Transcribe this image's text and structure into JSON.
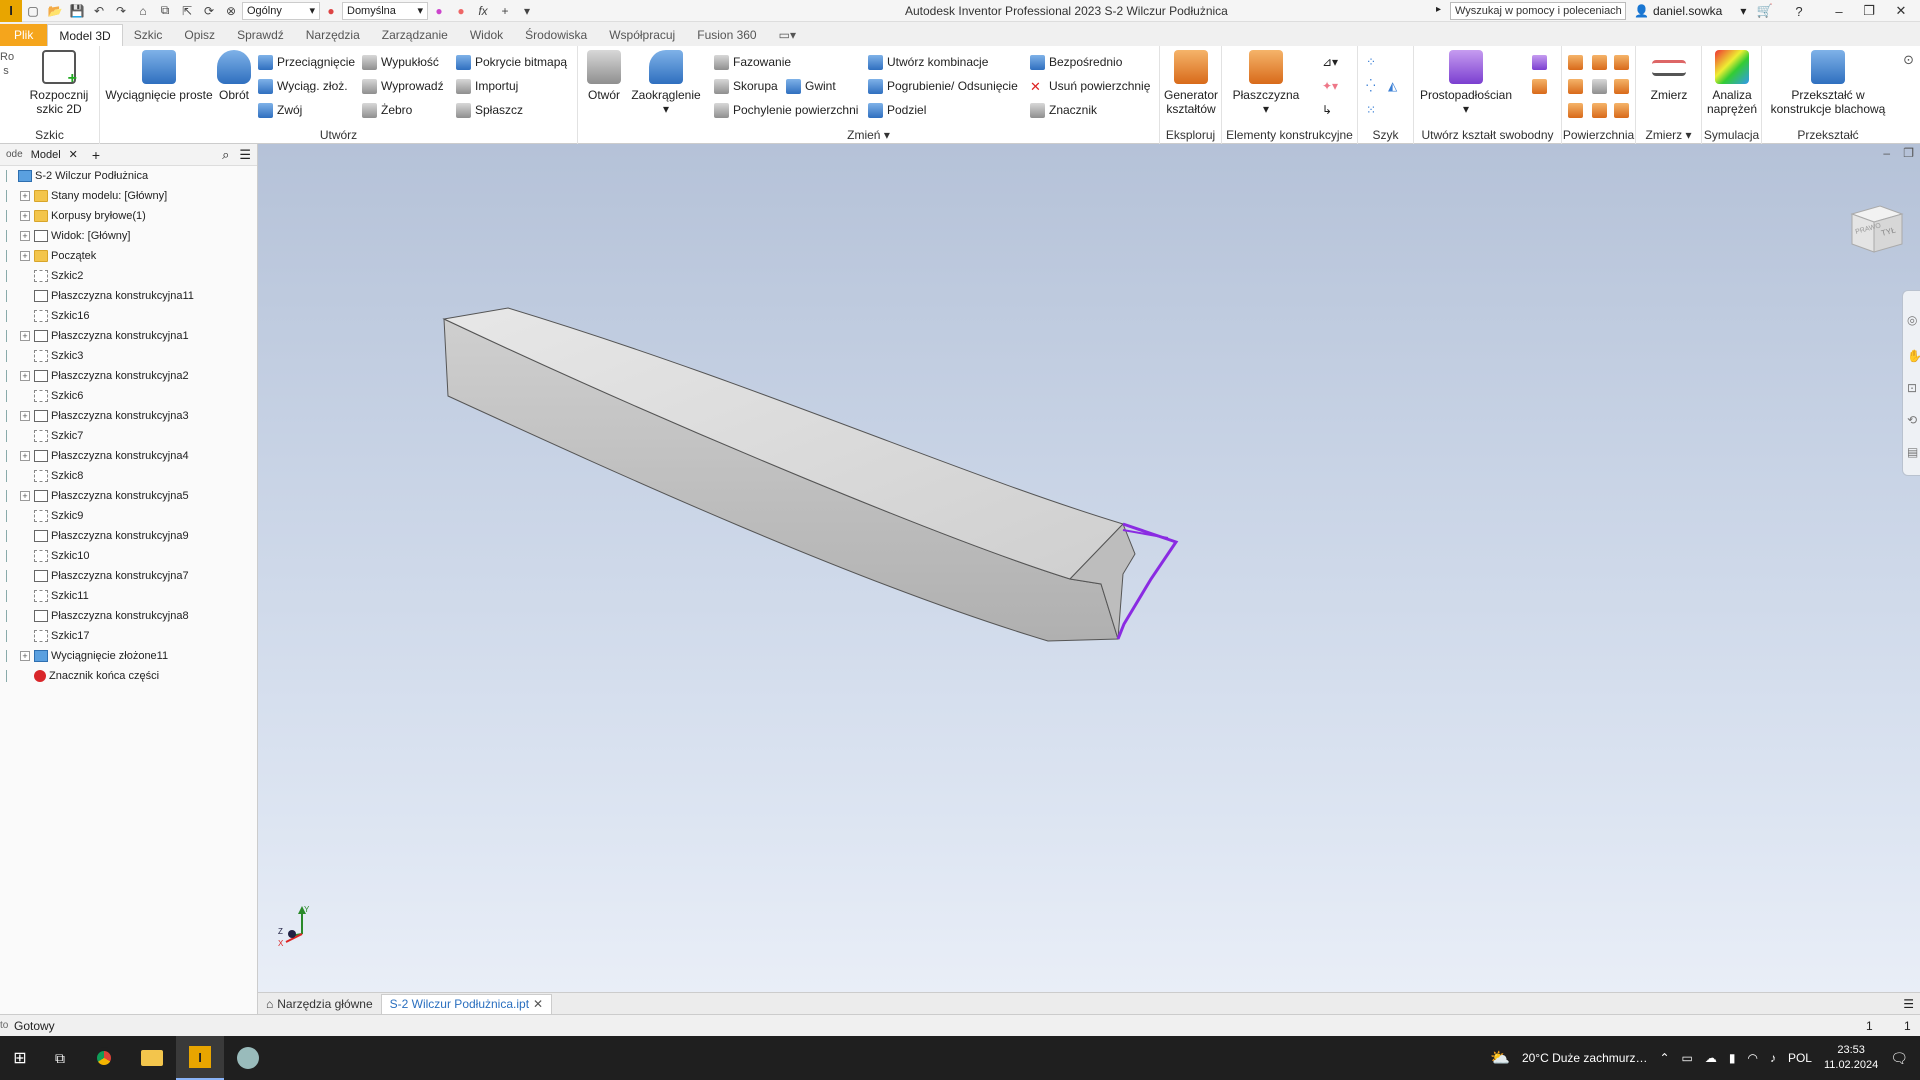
{
  "titlebar": {
    "app_letter": "I",
    "style_combo": "Ogólny",
    "appearance_combo": "Domyślna",
    "title": "Autodesk Inventor Professional 2023   S-2 Wilczur Podłużnica",
    "help_search_placeholder": "Wyszukaj w pomocy i poleceniach",
    "user": "daniel.sowka"
  },
  "ribbon_tabs": [
    "Plik",
    "Model 3D",
    "Szkic",
    "Opisz",
    "Sprawdź",
    "Narzędzia",
    "Zarządzanie",
    "Widok",
    "Środowiska",
    "Współpracuj",
    "Fusion 360"
  ],
  "ribbon": {
    "sketch_group": {
      "label": "Szkic",
      "start_sketch": "Rozpocznij szkic 2D"
    },
    "create_group": {
      "label": "Utwórz",
      "extrude": "Wyciągnięcie proste",
      "revolve": "Obrót",
      "sweep": "Przeciągnięcie",
      "loft": "Wyciąg. złoż.",
      "coil": "Zwój",
      "emboss": "Wypukłość",
      "derive": "Wyprowadź",
      "rib": "Żebro",
      "decal": "Pokrycie bitmapą",
      "import": "Importuj",
      "unwrap": "Spłaszcz"
    },
    "modify_group": {
      "label": "Zmień",
      "hole": "Otwór",
      "fillet": "Zaokrąglenie",
      "chamfer": "Fazowanie",
      "shell": "Skorupa",
      "thread": "Gwint",
      "draft": "Pochylenie powierzchni",
      "combine": "Utwórz kombinacje",
      "thicken": "Pogrubienie/ Odsunięcie",
      "split": "Podziel",
      "direct": "Bezpośrednio",
      "delete_face": "Usuń powierzchnię",
      "mark": "Znacznik"
    },
    "explore_group": {
      "label": "Eksploruj",
      "shape_generator": "Generator kształtów"
    },
    "work_features_group": {
      "label": "Elementy konstrukcyjne",
      "plane": "Płaszczyzna"
    },
    "pattern_group": {
      "label": "Szyk"
    },
    "freeform_group": {
      "label": "Utwórz kształt swobodny",
      "box": "Prostopadłościan"
    },
    "surface_group": {
      "label": "Powierzchnia"
    },
    "measure_group": {
      "label": "Zmierz",
      "measure": "Zmierz"
    },
    "simulation_group": {
      "label": "Symulacja",
      "stress": "Analiza naprężeń"
    },
    "convert_group": {
      "label": "Przekształć",
      "to_sheetmetal": "Przekształć w konstrukcje blachową"
    }
  },
  "browser": {
    "tab": "Model",
    "items": [
      {
        "label": "S-2 Wilczur Podłużnica",
        "icon": "part",
        "level": 0,
        "expander": ""
      },
      {
        "label": "Stany modelu: [Główny]",
        "icon": "folder",
        "level": 1,
        "expander": "+"
      },
      {
        "label": "Korpusy bryłowe(1)",
        "icon": "folder",
        "level": 1,
        "expander": "+"
      },
      {
        "label": "Widok: [Główny]",
        "icon": "view",
        "level": 1,
        "expander": "+"
      },
      {
        "label": "Początek",
        "icon": "folder",
        "level": 1,
        "expander": "+"
      },
      {
        "label": "Szkic2",
        "icon": "sketch",
        "level": 1,
        "expander": ""
      },
      {
        "label": "Płaszczyzna konstrukcyjna11",
        "icon": "plane",
        "level": 1,
        "expander": ""
      },
      {
        "label": "Szkic16",
        "icon": "sketch",
        "level": 1,
        "expander": ""
      },
      {
        "label": "Płaszczyzna konstrukcyjna1",
        "icon": "plane",
        "level": 1,
        "expander": "+"
      },
      {
        "label": "Szkic3",
        "icon": "sketch",
        "level": 1,
        "expander": ""
      },
      {
        "label": "Płaszczyzna konstrukcyjna2",
        "icon": "plane",
        "level": 1,
        "expander": "+"
      },
      {
        "label": "Szkic6",
        "icon": "sketch",
        "level": 1,
        "expander": ""
      },
      {
        "label": "Płaszczyzna konstrukcyjna3",
        "icon": "plane",
        "level": 1,
        "expander": "+"
      },
      {
        "label": "Szkic7",
        "icon": "sketch",
        "level": 1,
        "expander": ""
      },
      {
        "label": "Płaszczyzna konstrukcyjna4",
        "icon": "plane",
        "level": 1,
        "expander": "+"
      },
      {
        "label": "Szkic8",
        "icon": "sketch",
        "level": 1,
        "expander": ""
      },
      {
        "label": "Płaszczyzna konstrukcyjna5",
        "icon": "plane",
        "level": 1,
        "expander": "+"
      },
      {
        "label": "Szkic9",
        "icon": "sketch",
        "level": 1,
        "expander": ""
      },
      {
        "label": "Płaszczyzna konstrukcyjna9",
        "icon": "plane",
        "level": 1,
        "expander": ""
      },
      {
        "label": "Szkic10",
        "icon": "sketch",
        "level": 1,
        "expander": ""
      },
      {
        "label": "Płaszczyzna konstrukcyjna7",
        "icon": "plane",
        "level": 1,
        "expander": ""
      },
      {
        "label": "Szkic11",
        "icon": "sketch",
        "level": 1,
        "expander": ""
      },
      {
        "label": "Płaszczyzna konstrukcyjna8",
        "icon": "plane",
        "level": 1,
        "expander": ""
      },
      {
        "label": "Szkic17",
        "icon": "sketch",
        "level": 1,
        "expander": ""
      },
      {
        "label": "Wyciągnięcie złożone11",
        "icon": "part",
        "level": 1,
        "expander": "+"
      },
      {
        "label": "Znacznik końca części",
        "icon": "error",
        "level": 1,
        "expander": ""
      }
    ]
  },
  "viewcube": {
    "face_front": "PRAWO",
    "face_back": "TYŁ"
  },
  "doc_tabs": {
    "home": "Narzędzia główne",
    "active": "S-2 Wilczur Podłużnica.ipt"
  },
  "status": {
    "text": "Gotowy",
    "count1": "1",
    "count2": "1"
  },
  "taskbar": {
    "weather": "20°C  Duże zachmurz…",
    "lang": "POL",
    "time": "23:53",
    "date": "11.02.2024"
  }
}
